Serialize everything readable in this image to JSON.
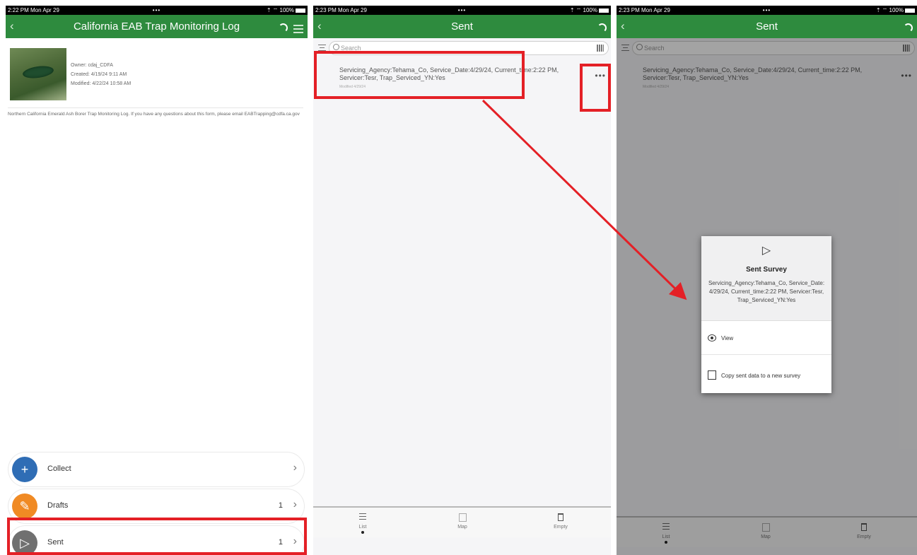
{
  "statusbar": {
    "p1_time": "2:22 PM  Mon Apr 29",
    "p2_time": "2:23 PM  Mon Apr 29",
    "p3_time": "2:23 PM  Mon Apr 29",
    "dots": "•••",
    "p1_right": "⇡  ⌔ 100%",
    "p2_right": "⇡  ⌔ 100%",
    "p3_right": "⇡  ⌔ 100%"
  },
  "panel1": {
    "title": "California EAB Trap Monitoring  Log",
    "owner": "Owner: cdaj_CDFA",
    "created": "Created: 4/19/24 9:11 AM",
    "modified": "Modified: 4/22/24 10:58 AM",
    "description": "Northern California Emerald Ash Borer Trap Monitoring Log. If you have any questions about this form, please email EABTrapping@cdfa.ca.gov",
    "menu": [
      {
        "label": "Collect",
        "count": "",
        "icon": "plus",
        "color": "#2f6db5"
      },
      {
        "label": "Drafts",
        "count": "1",
        "icon": "pencil",
        "color": "#f08a24"
      },
      {
        "label": "Sent",
        "count": "1",
        "icon": "send",
        "color": "#707070"
      }
    ]
  },
  "panel2": {
    "title": "Sent",
    "search_placeholder": "Search",
    "record_text": "Servicing_Agency:Tehama_Co, Service_Date:4/29/24, Current_time:2:22 PM, Servicer:Tesr, Trap_Serviced_YN:Yes",
    "record_modified": "Modified 4/29/24",
    "more": "•••",
    "tabs": [
      "List",
      "Map",
      "Empty"
    ]
  },
  "panel3": {
    "title": "Sent",
    "search_placeholder": "Search",
    "record_text": "Servicing_Agency:Tehama_Co, Service_Date:4/29/24, Current_time:2:22 PM, Servicer:Tesr, Trap_Serviced_YN:Yes",
    "record_modified": "Modified 4/29/24",
    "more": "•••",
    "dialog": {
      "title": "Sent Survey",
      "body": "Servicing_Agency:Tehama_Co, Service_Date: 4/29/24, Current_time:2:22 PM, Servicer:Tesr, Trap_Serviced_YN:Yes",
      "option_view": "View",
      "option_copy": "Copy sent data to a new survey"
    },
    "tabs": [
      "List",
      "Map",
      "Empty"
    ]
  },
  "colors": {
    "navbar": "#2e8b3e",
    "highlight": "#e42026"
  }
}
